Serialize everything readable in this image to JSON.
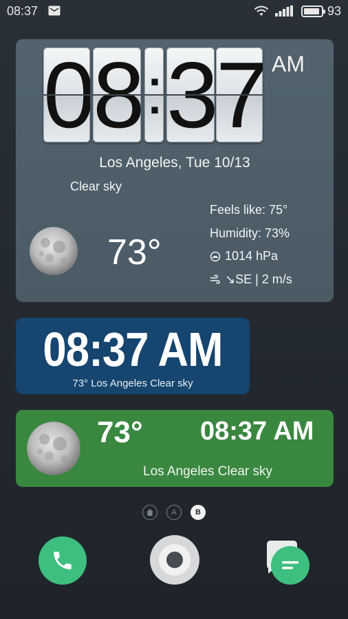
{
  "status_bar": {
    "time": "08:37",
    "battery_level": "93",
    "battery_fraction": 0.93
  },
  "widget_flip_clock": {
    "hour_digit_1": "0",
    "hour_digit_2": "8",
    "separator": ":",
    "minute_digit_1": "3",
    "minute_digit_2": "7",
    "ampm": "AM",
    "location_date": "Los Angeles, Tue 10/13",
    "condition": "Clear sky",
    "temperature": "73°",
    "feels_like": "Feels like: 75°",
    "humidity": "Humidity: 73%",
    "pressure": "1014 hPa",
    "wind": "↘SE | 2 m/s",
    "weather_icon": "full-moon-icon"
  },
  "widget_digital_clock": {
    "time": "08:37 AM",
    "subtitle": "73° Los Angeles Clear sky"
  },
  "widget_green": {
    "temperature": "73°",
    "time": "08:37 AM",
    "location_condition": "Los Angeles Clear sky",
    "weather_icon": "full-moon-icon"
  },
  "page_indicator": {
    "pages": [
      "home-icon",
      "A",
      "B"
    ],
    "active_label": "B"
  },
  "dock": {
    "apps": [
      "phone-icon",
      "home-button-icon",
      "messages-icon"
    ]
  },
  "colors": {
    "widget_flip_bg": "#4b5b66",
    "widget_blue_bg": "#16456f",
    "widget_green_bg": "#3a8740",
    "phone_green": "#3fbf7f"
  }
}
